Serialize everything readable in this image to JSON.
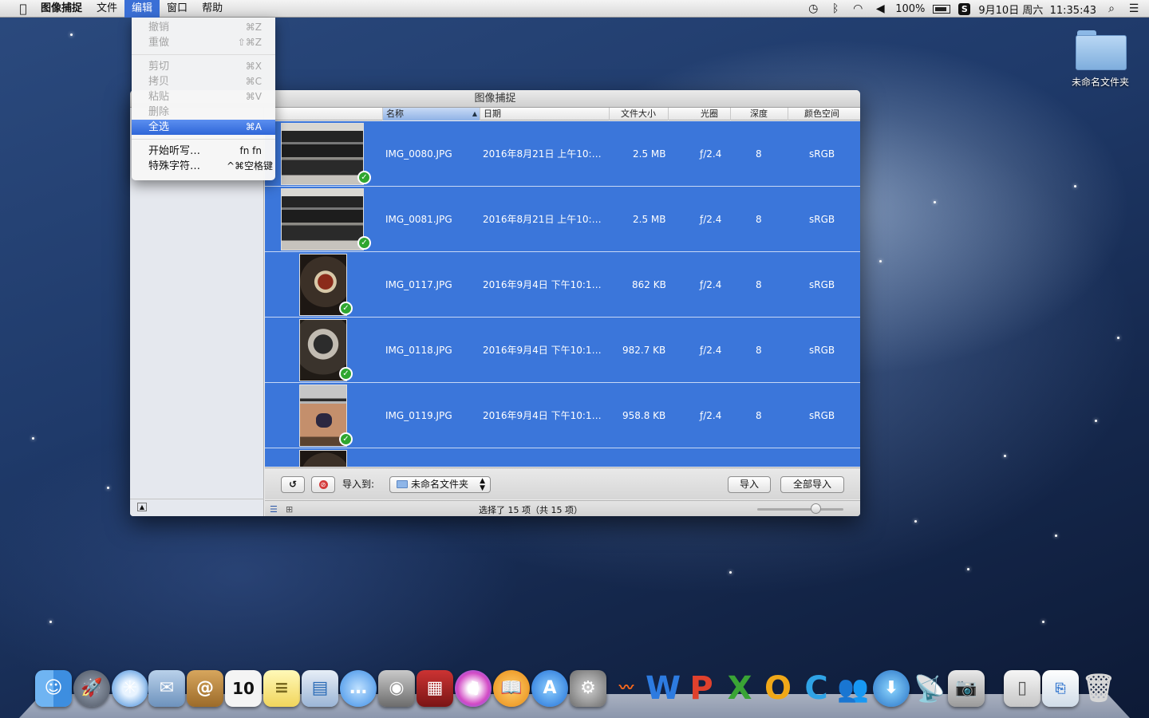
{
  "menubar": {
    "apple_icon": "apple-logo-icon",
    "items": [
      "图像捕捉",
      "文件",
      "编辑",
      "窗口",
      "帮助"
    ],
    "battery": "100%",
    "sogou": "S",
    "datetime": "9月10日 周六  11:35:43"
  },
  "edit_menu": {
    "items": [
      {
        "label": "撤销",
        "shortcut": "⌘Z"
      },
      {
        "label": "重做",
        "shortcut": "⇧⌘Z"
      },
      {
        "label": "剪切",
        "shortcut": "⌘X"
      },
      {
        "label": "拷贝",
        "shortcut": "⌘C"
      },
      {
        "label": "粘贴",
        "shortcut": "⌘V"
      },
      {
        "label": "删除",
        "shortcut": ""
      },
      {
        "label": "全选",
        "shortcut": "⌘A"
      },
      {
        "label": "开始听写…",
        "shortcut": "fn fn"
      },
      {
        "label": "特殊字符…",
        "shortcut": "^⌘空格键"
      }
    ]
  },
  "window": {
    "title": "图像捕捉",
    "columns": [
      "名称",
      "日期",
      "文件大小",
      "光圈",
      "深度",
      "颜色空间"
    ],
    "rows": [
      {
        "name": "IMG_0080.JPG",
        "date": "2016年8月21日 上午10:…",
        "size": "2.5 MB",
        "aperture": "ƒ/2.4",
        "depth": "8",
        "colorspace": "sRGB"
      },
      {
        "name": "IMG_0081.JPG",
        "date": "2016年8月21日 上午10:…",
        "size": "2.5 MB",
        "aperture": "ƒ/2.4",
        "depth": "8",
        "colorspace": "sRGB"
      },
      {
        "name": "IMG_0117.JPG",
        "date": "2016年9月4日 下午10:1…",
        "size": "862 KB",
        "aperture": "ƒ/2.4",
        "depth": "8",
        "colorspace": "sRGB"
      },
      {
        "name": "IMG_0118.JPG",
        "date": "2016年9月4日 下午10:1…",
        "size": "982.7 KB",
        "aperture": "ƒ/2.4",
        "depth": "8",
        "colorspace": "sRGB"
      },
      {
        "name": "IMG_0119.JPG",
        "date": "2016年9月4日 下午10:1…",
        "size": "958.8 KB",
        "aperture": "ƒ/2.4",
        "depth": "8",
        "colorspace": "sRGB"
      }
    ],
    "toolbar": {
      "rotate_label": "↺",
      "import_to_label": "导入到:",
      "destination": "未命名文件夹",
      "import_button": "导入",
      "import_all_button": "全部导入"
    },
    "status": "选择了 15 项（共 15 项）",
    "zoom": 0.7
  },
  "desktop": {
    "folder_label": "未命名文件夹"
  },
  "dock": {
    "items": [
      "finder-icon",
      "launchpad-icon",
      "safari-icon",
      "mail-icon",
      "contacts-icon",
      "calendar-icon",
      "notes-icon",
      "preview-icon",
      "messages-icon",
      "facetime-icon",
      "photo-booth-icon",
      "itunes-icon",
      "ibooks-icon",
      "app-store-icon",
      "system-preferences-icon",
      "wps-icon",
      "word-icon",
      "powerpoint-icon",
      "excel-icon",
      "outlook-icon",
      "skype-icon",
      "user-icon",
      "download-icon",
      "network-icon",
      "image-capture-icon",
      "documents-icon",
      "downloads-stack-icon",
      "trash-icon"
    ],
    "calendar_day": "10"
  },
  "colors": {
    "selection": "#3b76da",
    "menu_highlight": "#3a6fd6"
  }
}
